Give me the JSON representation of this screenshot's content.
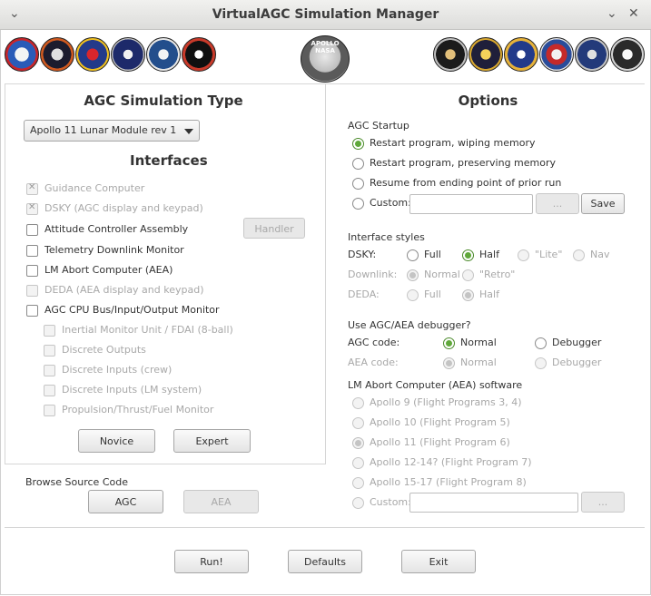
{
  "window": {
    "title": "VirtualAGC Simulation Manager"
  },
  "left": {
    "sim_type_title": "AGC Simulation Type",
    "sim_type_value": "Apollo 11 Lunar Module rev 1",
    "interfaces_title": "Interfaces",
    "interfaces": [
      {
        "label": "Guidance Computer",
        "checked": true,
        "enabled": false
      },
      {
        "label": "DSKY (AGC display and keypad)",
        "checked": true,
        "enabled": false
      },
      {
        "label": "Attitude Controller Assembly",
        "checked": false,
        "enabled": true
      },
      {
        "label": "Telemetry Downlink Monitor",
        "checked": false,
        "enabled": true
      },
      {
        "label": "LM Abort Computer (AEA)",
        "checked": false,
        "enabled": true
      },
      {
        "label": "DEDA (AEA display and keypad)",
        "checked": false,
        "enabled": false
      },
      {
        "label": "AGC CPU Bus/Input/Output Monitor",
        "checked": false,
        "enabled": true
      },
      {
        "label": "Inertial Monitor Unit / FDAI (8-ball)",
        "checked": false,
        "enabled": false
      },
      {
        "label": "Discrete Outputs",
        "checked": false,
        "enabled": false
      },
      {
        "label": "Discrete Inputs (crew)",
        "checked": false,
        "enabled": false
      },
      {
        "label": "Discrete Inputs (LM system)",
        "checked": false,
        "enabled": false
      },
      {
        "label": "Propulsion/Thrust/Fuel Monitor",
        "checked": false,
        "enabled": false
      }
    ],
    "handler_label": "Handler",
    "novice_label": "Novice",
    "expert_label": "Expert",
    "browse_title": "Browse Source Code",
    "agc_label": "AGC",
    "aea_label": "AEA"
  },
  "options": {
    "title": "Options",
    "agc_startup": "AGC Startup",
    "startup": [
      {
        "label": "Restart program, wiping memory",
        "selected": true
      },
      {
        "label": "Restart program, preserving memory",
        "selected": false
      },
      {
        "label": "Resume from ending point of prior run",
        "selected": false
      },
      {
        "label": "Custom:",
        "selected": false
      }
    ],
    "browse_label": "...",
    "save_label": "Save",
    "interface_styles": "Interface styles",
    "dsky_label": "DSKY:",
    "dsky_opts": [
      {
        "label": "Full",
        "selected": false,
        "enabled": true
      },
      {
        "label": "Half",
        "selected": true,
        "enabled": true
      },
      {
        "label": "\"Lite\"",
        "selected": false,
        "enabled": false
      },
      {
        "label": "Nav",
        "selected": false,
        "enabled": false
      }
    ],
    "downlink_label": "Downlink:",
    "downlink_opts": [
      {
        "label": "Normal",
        "selected": true
      },
      {
        "label": "\"Retro\"",
        "selected": false
      }
    ],
    "deda_label": "DEDA:",
    "deda_opts": [
      {
        "label": "Full",
        "selected": false
      },
      {
        "label": "Half",
        "selected": true
      }
    ],
    "debugger_title": "Use AGC/AEA debugger?",
    "agc_code_label": "AGC code:",
    "agc_code_opts": [
      {
        "label": "Normal",
        "selected": true
      },
      {
        "label": "Debugger",
        "selected": false
      }
    ],
    "aea_code_label": "AEA code:",
    "aea_code_opts": [
      {
        "label": "Normal",
        "selected": true
      },
      {
        "label": "Debugger",
        "selected": false
      }
    ],
    "aea_software_title": "LM Abort Computer (AEA) software",
    "aea_software": [
      {
        "label": "Apollo 9 (Flight Programs 3, 4)",
        "selected": false
      },
      {
        "label": "Apollo 10 (Flight Program 5)",
        "selected": false
      },
      {
        "label": "Apollo 11 (Flight Program 6)",
        "selected": true
      },
      {
        "label": "Apollo 12-14? (Flight Program 7)",
        "selected": false
      },
      {
        "label": "Apollo 15-17 (Flight Program 8)",
        "selected": false
      },
      {
        "label": "Custom:",
        "selected": false
      }
    ],
    "aea_browse_label": "..."
  },
  "footer": {
    "run_label": "Run!",
    "defaults_label": "Defaults",
    "exit_label": "Exit"
  },
  "center_emblem_text": "APOLLO NASA"
}
